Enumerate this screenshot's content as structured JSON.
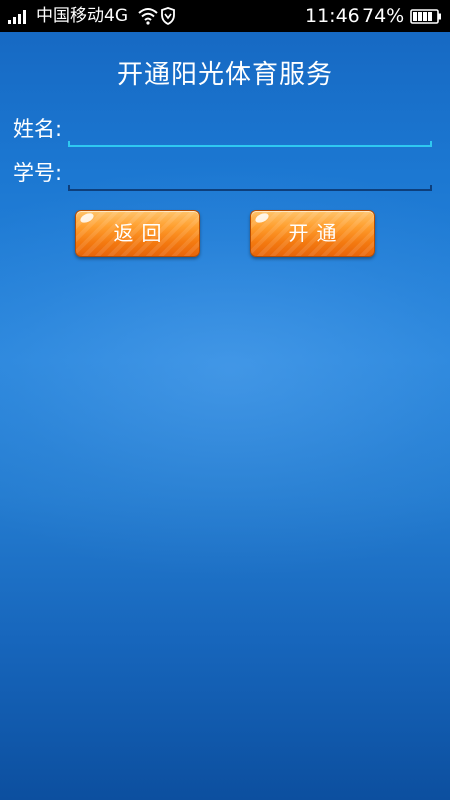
{
  "status_bar": {
    "carrier": "中国移动4G",
    "time": "11:46",
    "battery": "74%"
  },
  "page": {
    "title": "开通阳光体育服务"
  },
  "form": {
    "name_label": "姓名:",
    "name_value": "",
    "student_id_label": "学号:",
    "student_id_value": ""
  },
  "buttons": {
    "back_label": "返回",
    "open_label": "开通"
  },
  "colors": {
    "background": "#1c78d2",
    "button": "#f47a10",
    "active_underline": "#2fc8f0"
  }
}
